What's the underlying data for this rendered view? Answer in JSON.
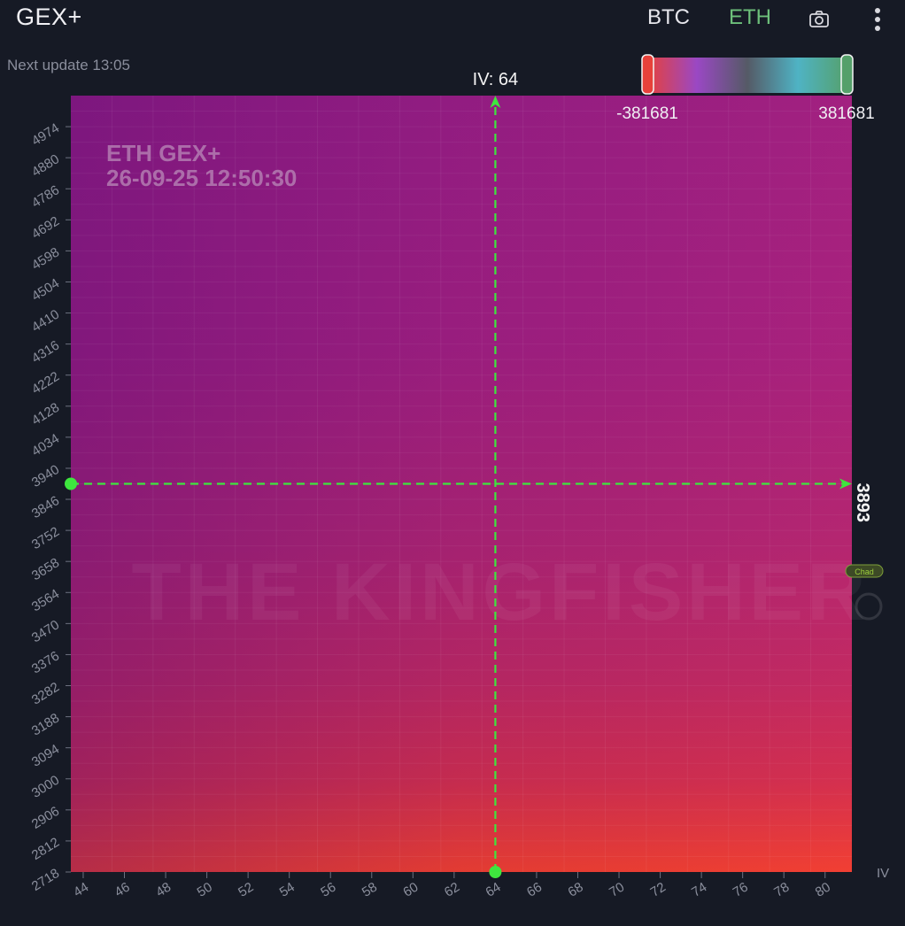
{
  "header": {
    "title": "GEX+",
    "assets": [
      {
        "label": "BTC",
        "active": false
      },
      {
        "label": "ETH",
        "active": true
      }
    ],
    "camera_icon": "camera-icon",
    "more_icon": "more-vertical-icon",
    "accent_color": "#6dbf7a"
  },
  "status": {
    "next_update": "Next update 13:05"
  },
  "color_scale": {
    "min_label": "-381681",
    "max_label": "381681",
    "min": -381681,
    "max": 381681,
    "colors": [
      "#e7413a",
      "#9a48c4",
      "#555a66",
      "#4fb3c4",
      "#55a06a"
    ]
  },
  "chart_data": {
    "type": "heatmap",
    "title": "ETH GEX+",
    "subtitle": "26-09-25 12:50:30",
    "xlabel": "IV",
    "ylabel": "",
    "x_ticks": [
      44,
      46,
      48,
      50,
      52,
      54,
      56,
      58,
      60,
      62,
      64,
      66,
      68,
      70,
      72,
      74,
      76,
      78,
      80
    ],
    "y_ticks": [
      2718,
      2812,
      2906,
      3000,
      3094,
      3188,
      3282,
      3376,
      3470,
      3564,
      3658,
      3752,
      3846,
      3940,
      4034,
      4128,
      4222,
      4316,
      4410,
      4504,
      4598,
      4692,
      4786,
      4880,
      4974
    ],
    "xlim": [
      43.4,
      81.3
    ],
    "ylim": [
      2718,
      5068
    ],
    "grid": true,
    "gradient": {
      "description_colors": [
        {
          "y": 5068,
          "left": "#741a9c",
          "right": "#981e82"
        },
        {
          "y": 4300,
          "left": "#7d1c9c",
          "right": "#a01f7e"
        },
        {
          "y": 3700,
          "left": "#8c1e92",
          "right": "#ad2470"
        },
        {
          "y": 3300,
          "left": "#a8246c",
          "right": "#bc2860"
        },
        {
          "y": 3000,
          "left": "#c62c52",
          "right": "#cf2e4c"
        },
        {
          "y": 2718,
          "left": "#ed3e30",
          "right": "#f0402c"
        }
      ]
    },
    "crosshair": {
      "iv": 64,
      "iv_label": "IV: 64",
      "price": 3893,
      "price_label": "3893",
      "color": "#3ee63e"
    },
    "watermark": "THE KINGFISHER",
    "badge": "Chad"
  }
}
